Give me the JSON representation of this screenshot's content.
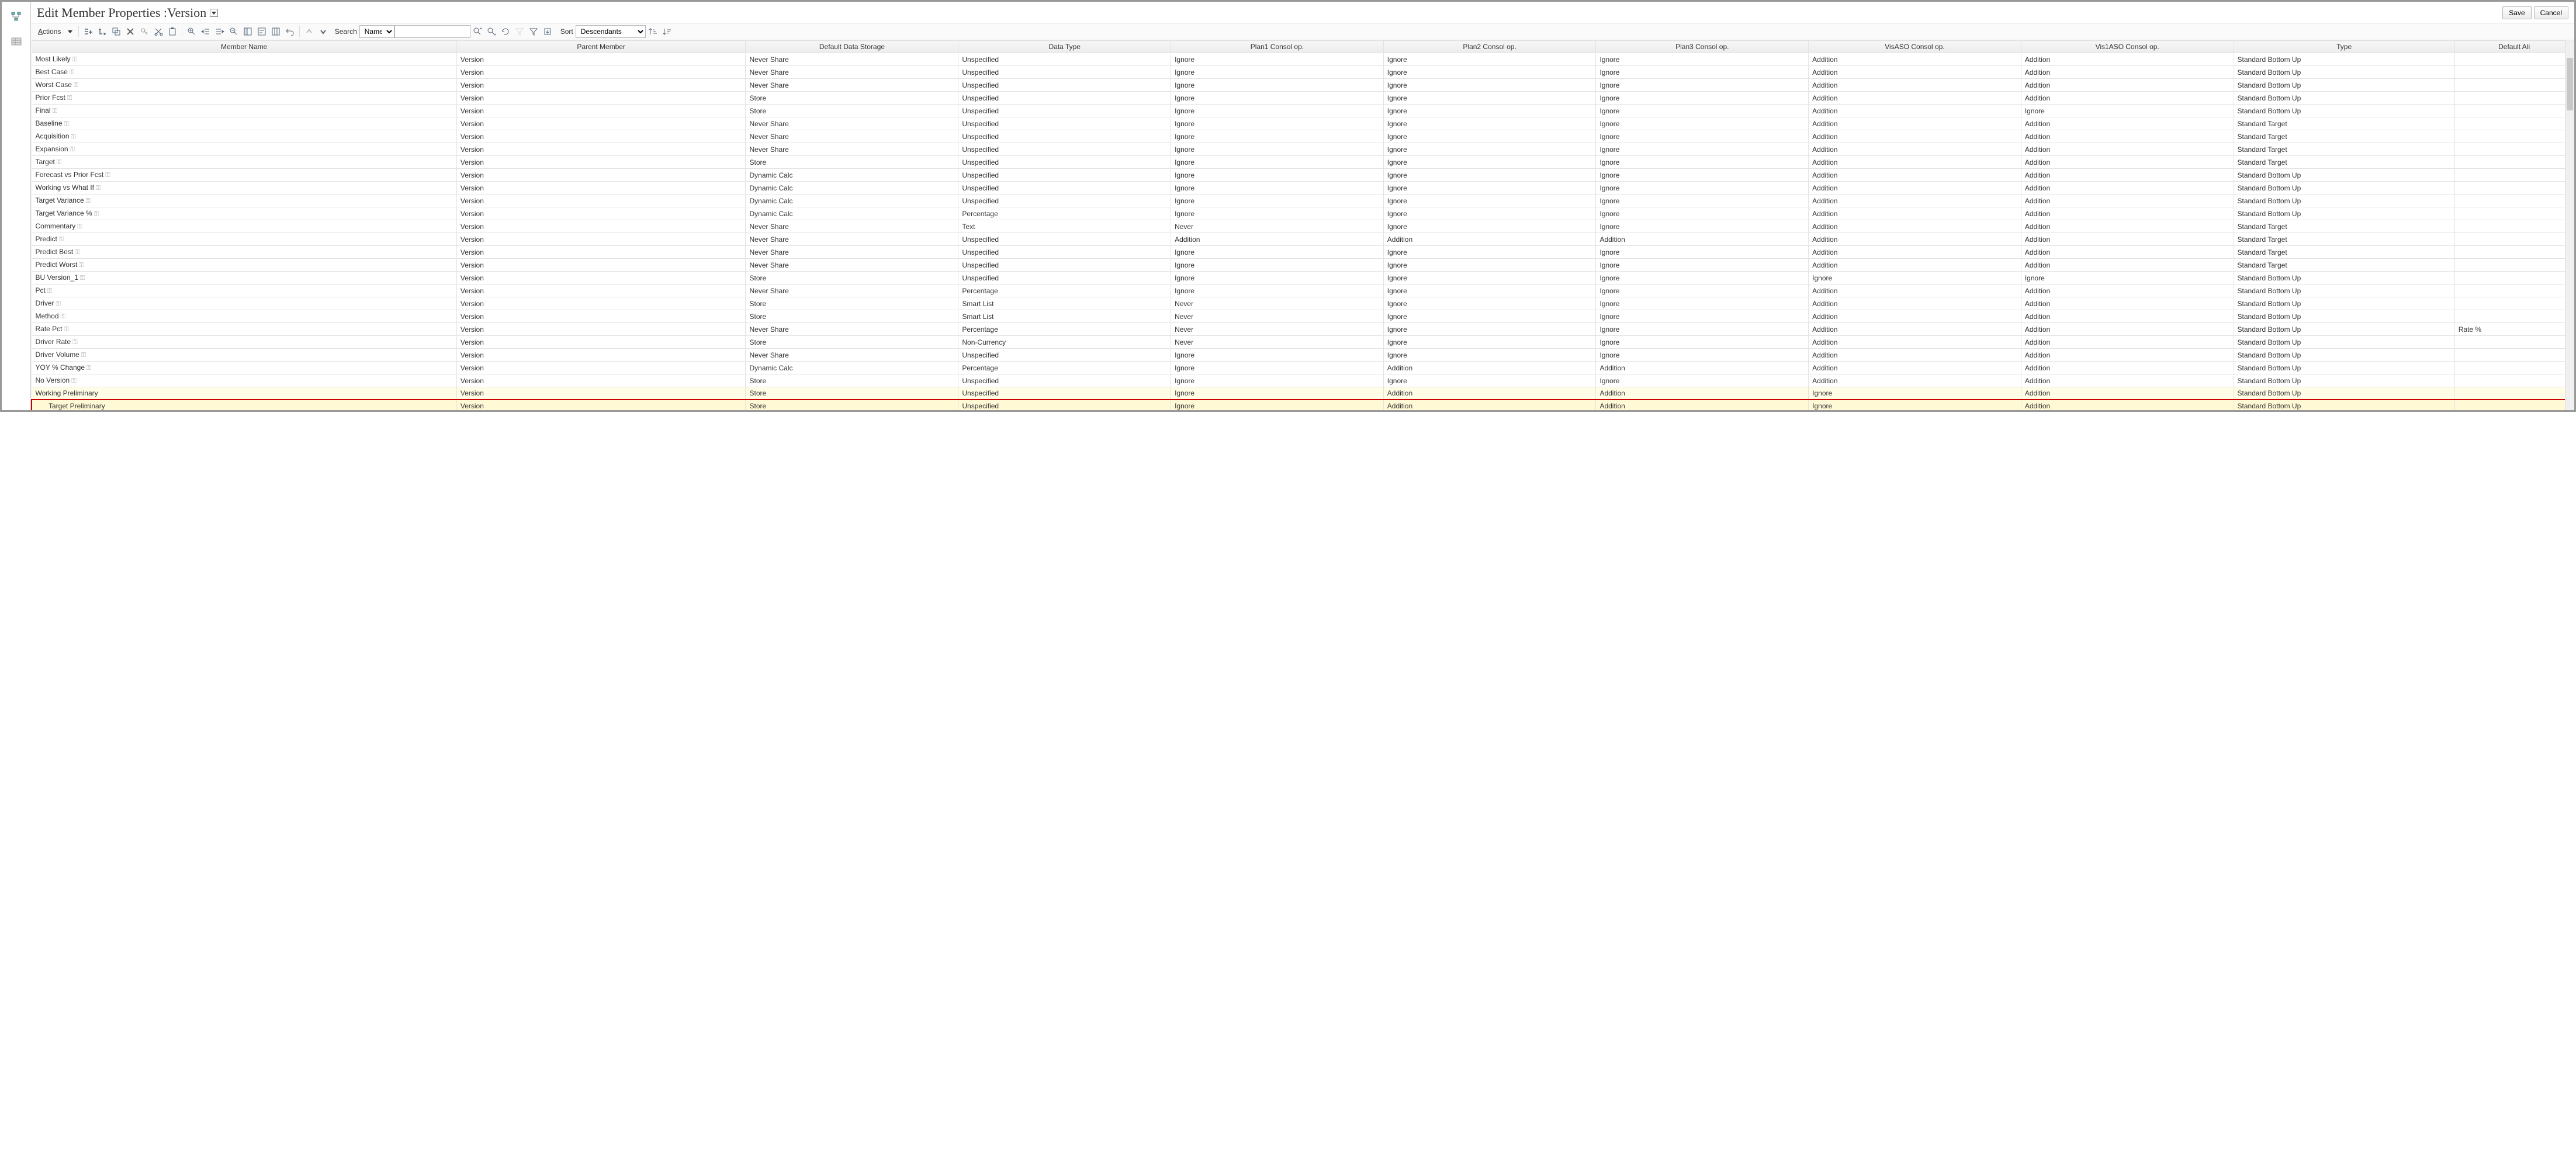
{
  "header": {
    "title_prefix": "Edit Member Properties :",
    "title_dim": "Version",
    "save": "Save",
    "cancel": "Cancel"
  },
  "toolbar": {
    "actions": "Actions",
    "search_label": "Search",
    "search_field": "Name",
    "search_value": "",
    "sort_label": "Sort",
    "sort_value": "Descendants"
  },
  "columns": [
    "Member Name",
    "Parent Member",
    "Default Data Storage",
    "Data Type",
    "Plan1 Consol op.",
    "Plan2 Consol op.",
    "Plan3 Consol op.",
    "VisASO Consol op.",
    "Vis1ASO Consol op.",
    "Type",
    "Default Ali"
  ],
  "rows": [
    {
      "name": "Most Likely",
      "key": true,
      "parent": "Version",
      "storage": "Never Share",
      "datatype": "Unspecified",
      "p1": "Ignore",
      "p2": "Ignore",
      "p3": "Ignore",
      "v1": "Addition",
      "v2": "Addition",
      "type": "Standard Bottom Up",
      "alias": ""
    },
    {
      "name": "Best Case",
      "key": true,
      "parent": "Version",
      "storage": "Never Share",
      "datatype": "Unspecified",
      "p1": "Ignore",
      "p2": "Ignore",
      "p3": "Ignore",
      "v1": "Addition",
      "v2": "Addition",
      "type": "Standard Bottom Up",
      "alias": ""
    },
    {
      "name": "Worst Case",
      "key": true,
      "parent": "Version",
      "storage": "Never Share",
      "datatype": "Unspecified",
      "p1": "Ignore",
      "p2": "Ignore",
      "p3": "Ignore",
      "v1": "Addition",
      "v2": "Addition",
      "type": "Standard Bottom Up",
      "alias": ""
    },
    {
      "name": "Prior Fcst",
      "key": true,
      "parent": "Version",
      "storage": "Store",
      "datatype": "Unspecified",
      "p1": "Ignore",
      "p2": "Ignore",
      "p3": "Ignore",
      "v1": "Addition",
      "v2": "Addition",
      "type": "Standard Bottom Up",
      "alias": ""
    },
    {
      "name": "Final",
      "key": true,
      "parent": "Version",
      "storage": "Store",
      "datatype": "Unspecified",
      "p1": "Ignore",
      "p2": "Ignore",
      "p3": "Ignore",
      "v1": "Addition",
      "v2": "Ignore",
      "type": "Standard Bottom Up",
      "alias": ""
    },
    {
      "name": "Baseline",
      "key": true,
      "parent": "Version",
      "storage": "Never Share",
      "datatype": "Unspecified",
      "p1": "Ignore",
      "p2": "Ignore",
      "p3": "Ignore",
      "v1": "Addition",
      "v2": "Addition",
      "type": "Standard Target",
      "alias": ""
    },
    {
      "name": "Acquisition",
      "key": true,
      "parent": "Version",
      "storage": "Never Share",
      "datatype": "Unspecified",
      "p1": "Ignore",
      "p2": "Ignore",
      "p3": "Ignore",
      "v1": "Addition",
      "v2": "Addition",
      "type": "Standard Target",
      "alias": ""
    },
    {
      "name": "Expansion",
      "key": true,
      "parent": "Version",
      "storage": "Never Share",
      "datatype": "Unspecified",
      "p1": "Ignore",
      "p2": "Ignore",
      "p3": "Ignore",
      "v1": "Addition",
      "v2": "Addition",
      "type": "Standard Target",
      "alias": ""
    },
    {
      "name": "Target",
      "key": true,
      "parent": "Version",
      "storage": "Store",
      "datatype": "Unspecified",
      "p1": "Ignore",
      "p2": "Ignore",
      "p3": "Ignore",
      "v1": "Addition",
      "v2": "Addition",
      "type": "Standard Target",
      "alias": ""
    },
    {
      "name": "Forecast vs Prior Fcst",
      "key": true,
      "parent": "Version",
      "storage": "Dynamic Calc",
      "datatype": "Unspecified",
      "p1": "Ignore",
      "p2": "Ignore",
      "p3": "Ignore",
      "v1": "Addition",
      "v2": "Addition",
      "type": "Standard Bottom Up",
      "alias": ""
    },
    {
      "name": "Working vs What If",
      "key": true,
      "parent": "Version",
      "storage": "Dynamic Calc",
      "datatype": "Unspecified",
      "p1": "Ignore",
      "p2": "Ignore",
      "p3": "Ignore",
      "v1": "Addition",
      "v2": "Addition",
      "type": "Standard Bottom Up",
      "alias": ""
    },
    {
      "name": "Target Variance",
      "key": true,
      "parent": "Version",
      "storage": "Dynamic Calc",
      "datatype": "Unspecified",
      "p1": "Ignore",
      "p2": "Ignore",
      "p3": "Ignore",
      "v1": "Addition",
      "v2": "Addition",
      "type": "Standard Bottom Up",
      "alias": ""
    },
    {
      "name": "Target Variance %",
      "key": true,
      "parent": "Version",
      "storage": "Dynamic Calc",
      "datatype": "Percentage",
      "p1": "Ignore",
      "p2": "Ignore",
      "p3": "Ignore",
      "v1": "Addition",
      "v2": "Addition",
      "type": "Standard Bottom Up",
      "alias": ""
    },
    {
      "name": "Commentary",
      "key": true,
      "parent": "Version",
      "storage": "Never Share",
      "datatype": "Text",
      "p1": "Never",
      "p2": "Ignore",
      "p3": "Ignore",
      "v1": "Addition",
      "v2": "Addition",
      "type": "Standard Target",
      "alias": ""
    },
    {
      "name": "Predict",
      "key": true,
      "parent": "Version",
      "storage": "Never Share",
      "datatype": "Unspecified",
      "p1": "Addition",
      "p2": "Addition",
      "p3": "Addition",
      "v1": "Addition",
      "v2": "Addition",
      "type": "Standard Target",
      "alias": ""
    },
    {
      "name": "Predict Best",
      "key": true,
      "parent": "Version",
      "storage": "Never Share",
      "datatype": "Unspecified",
      "p1": "Ignore",
      "p2": "Ignore",
      "p3": "Ignore",
      "v1": "Addition",
      "v2": "Addition",
      "type": "Standard Target",
      "alias": ""
    },
    {
      "name": "Predict Worst",
      "key": true,
      "parent": "Version",
      "storage": "Never Share",
      "datatype": "Unspecified",
      "p1": "Ignore",
      "p2": "Ignore",
      "p3": "Ignore",
      "v1": "Addition",
      "v2": "Addition",
      "type": "Standard Target",
      "alias": ""
    },
    {
      "name": "BU Version_1",
      "key": true,
      "parent": "Version",
      "storage": "Store",
      "datatype": "Unspecified",
      "p1": "Ignore",
      "p2": "Ignore",
      "p3": "Ignore",
      "v1": "Ignore",
      "v2": "Ignore",
      "type": "Standard Bottom Up",
      "alias": ""
    },
    {
      "name": "Pct",
      "key": true,
      "parent": "Version",
      "storage": "Never Share",
      "datatype": "Percentage",
      "p1": "Ignore",
      "p2": "Ignore",
      "p3": "Ignore",
      "v1": "Addition",
      "v2": "Addition",
      "type": "Standard Bottom Up",
      "alias": ""
    },
    {
      "name": "Driver",
      "key": true,
      "parent": "Version",
      "storage": "Store",
      "datatype": "Smart List",
      "p1": "Never",
      "p2": "Ignore",
      "p3": "Ignore",
      "v1": "Addition",
      "v2": "Addition",
      "type": "Standard Bottom Up",
      "alias": ""
    },
    {
      "name": "Method",
      "key": true,
      "parent": "Version",
      "storage": "Store",
      "datatype": "Smart List",
      "p1": "Never",
      "p2": "Ignore",
      "p3": "Ignore",
      "v1": "Addition",
      "v2": "Addition",
      "type": "Standard Bottom Up",
      "alias": ""
    },
    {
      "name": "Rate Pct",
      "key": true,
      "parent": "Version",
      "storage": "Never Share",
      "datatype": "Percentage",
      "p1": "Never",
      "p2": "Ignore",
      "p3": "Ignore",
      "v1": "Addition",
      "v2": "Addition",
      "type": "Standard Bottom Up",
      "alias": "Rate %"
    },
    {
      "name": "Driver Rate",
      "key": true,
      "parent": "Version",
      "storage": "Store",
      "datatype": "Non-Currency",
      "p1": "Never",
      "p2": "Ignore",
      "p3": "Ignore",
      "v1": "Addition",
      "v2": "Addition",
      "type": "Standard Bottom Up",
      "alias": ""
    },
    {
      "name": "Driver Volume",
      "key": true,
      "parent": "Version",
      "storage": "Never Share",
      "datatype": "Unspecified",
      "p1": "Ignore",
      "p2": "Ignore",
      "p3": "Ignore",
      "v1": "Addition",
      "v2": "Addition",
      "type": "Standard Bottom Up",
      "alias": ""
    },
    {
      "name": "YOY % Change",
      "key": true,
      "parent": "Version",
      "storage": "Dynamic Calc",
      "datatype": "Percentage",
      "p1": "Ignore",
      "p2": "Addition",
      "p3": "Addition",
      "v1": "Addition",
      "v2": "Addition",
      "type": "Standard Bottom Up",
      "alias": ""
    },
    {
      "name": "No Version",
      "key": true,
      "parent": "Version",
      "storage": "Store",
      "datatype": "Unspecified",
      "p1": "Ignore",
      "p2": "Ignore",
      "p3": "Ignore",
      "v1": "Addition",
      "v2": "Addition",
      "type": "Standard Bottom Up",
      "alias": ""
    },
    {
      "name": "Working Preliminary",
      "key": false,
      "parent": "Version",
      "storage": "Store",
      "datatype": "Unspecified",
      "p1": "Ignore",
      "p2": "Addition",
      "p3": "Addition",
      "v1": "Ignore",
      "v2": "Addition",
      "type": "Standard Bottom Up",
      "alias": "",
      "highlight": true
    },
    {
      "name": "Target Preliminary",
      "key": false,
      "indent": 1,
      "parent": "Version",
      "storage": "Store",
      "datatype": "Unspecified",
      "p1": "Ignore",
      "p2": "Addition",
      "p3": "Addition",
      "v1": "Ignore",
      "v2": "Addition",
      "type": "Standard Bottom Up",
      "alias": "",
      "highlight": true,
      "redbox": true
    }
  ]
}
